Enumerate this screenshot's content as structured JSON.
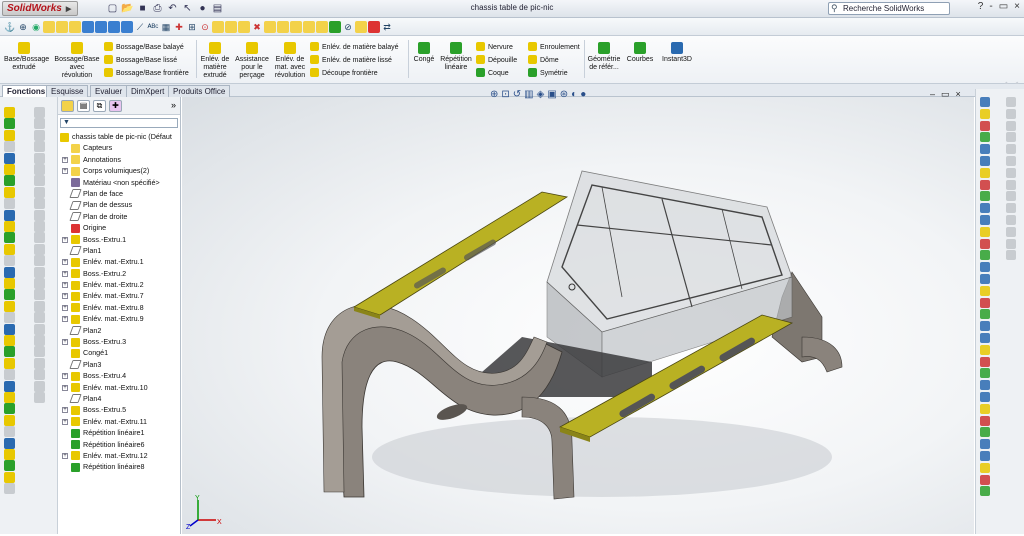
{
  "app": {
    "logo_text": "SolidWorks",
    "doc_title": "chassis table de pic-nic"
  },
  "search": {
    "placeholder": "Recherche SolidWorks"
  },
  "window_buttons": [
    "?",
    "-",
    "▭",
    "×"
  ],
  "command_manager": {
    "features": [
      {
        "label": "Base/Bossage extrudé",
        "color": "#e8c800"
      },
      {
        "label": "Bossage/Base avec révolution",
        "color": "#e8c800"
      }
    ],
    "boss_stack": [
      "Bossage/Base balayé",
      "Bossage/Base lissé",
      "Bossage/Base frontière"
    ],
    "cut_features": [
      {
        "label": "Enlév. de matière extrudé",
        "color": "#e8c800"
      },
      {
        "label": "Assistance pour le perçage",
        "color": "#e8c800"
      },
      {
        "label": "Enlév. de mat. avec révolution",
        "color": "#e8c800"
      }
    ],
    "cut_stack": [
      "Enlév. de matière balayé",
      "Enlév. de matière lissé",
      "Découpe frontière"
    ],
    "misc": [
      {
        "label": "Congé",
        "color": "#2aa02a"
      },
      {
        "label": "Répétition linéaire",
        "color": "#2aa02a"
      }
    ],
    "misc_stack1": [
      "Nervure",
      "Dépouille",
      "Coque"
    ],
    "misc_stack2": [
      "Enroulement",
      "Dôme",
      "Symétrie"
    ],
    "refgeom": [
      {
        "label": "Géométrie de référ...",
        "color": "#2aa02a"
      },
      {
        "label": "Courbes",
        "color": "#2aa02a"
      },
      {
        "label": "Instant3D",
        "color": "#2a6ab0"
      }
    ]
  },
  "tabs": [
    "Fonctions",
    "Esquisse",
    "Evaluer",
    "DimXpert",
    "Produits Office"
  ],
  "feature_tree": {
    "root": "chassis table de pic-nic  (Défaut",
    "items": [
      {
        "label": "Capteurs",
        "type": "folder",
        "expand": false
      },
      {
        "label": "Annotations",
        "type": "annot",
        "expand": true
      },
      {
        "label": "Corps volumiques(2)",
        "type": "folder",
        "expand": true
      },
      {
        "label": "Matériau <non spécifié>",
        "type": "material",
        "expand": false
      },
      {
        "label": "Plan de face",
        "type": "plane",
        "expand": false
      },
      {
        "label": "Plan de dessus",
        "type": "plane",
        "expand": false
      },
      {
        "label": "Plan de droite",
        "type": "plane",
        "expand": false
      },
      {
        "label": "Origine",
        "type": "origin",
        "expand": false
      },
      {
        "label": "Boss.-Extru.1",
        "type": "feature",
        "expand": true
      },
      {
        "label": "Plan1",
        "type": "plane",
        "expand": false
      },
      {
        "label": "Enlév. mat.-Extru.1",
        "type": "feature",
        "expand": true
      },
      {
        "label": "Boss.-Extru.2",
        "type": "feature",
        "expand": true
      },
      {
        "label": "Enlév. mat.-Extru.2",
        "type": "feature",
        "expand": true
      },
      {
        "label": "Enlév. mat.-Extru.7",
        "type": "feature",
        "expand": true
      },
      {
        "label": "Enlév. mat.-Extru.8",
        "type": "feature",
        "expand": true
      },
      {
        "label": "Enlév. mat.-Extru.9",
        "type": "feature",
        "expand": true
      },
      {
        "label": "Plan2",
        "type": "plane",
        "expand": false
      },
      {
        "label": "Boss.-Extru.3",
        "type": "feature",
        "expand": true
      },
      {
        "label": "Congé1",
        "type": "fillet",
        "expand": false
      },
      {
        "label": "Plan3",
        "type": "plane",
        "expand": false
      },
      {
        "label": "Boss.-Extru.4",
        "type": "feature",
        "expand": true
      },
      {
        "label": "Enlév. mat.-Extru.10",
        "type": "feature",
        "expand": true
      },
      {
        "label": "Plan4",
        "type": "plane",
        "expand": false
      },
      {
        "label": "Boss.-Extru.5",
        "type": "feature",
        "expand": true
      },
      {
        "label": "Enlév. mat.-Extru.11",
        "type": "feature",
        "expand": true
      },
      {
        "label": "Répétition linéaire1",
        "type": "pattern",
        "expand": false
      },
      {
        "label": "Répétition linéaire6",
        "type": "pattern",
        "expand": false
      },
      {
        "label": "Enlév. mat.-Extru.12",
        "type": "feature",
        "expand": true
      },
      {
        "label": "Répétition linéaire8",
        "type": "pattern",
        "expand": false
      }
    ]
  },
  "triad": {
    "x": "X",
    "y": "Y",
    "z": "Z"
  },
  "colors": {
    "accent": "#2a6ab0",
    "yellow": "#e8c800",
    "green": "#2aa02a",
    "model_gray": "#8a837c",
    "plank": "#b9b123"
  }
}
